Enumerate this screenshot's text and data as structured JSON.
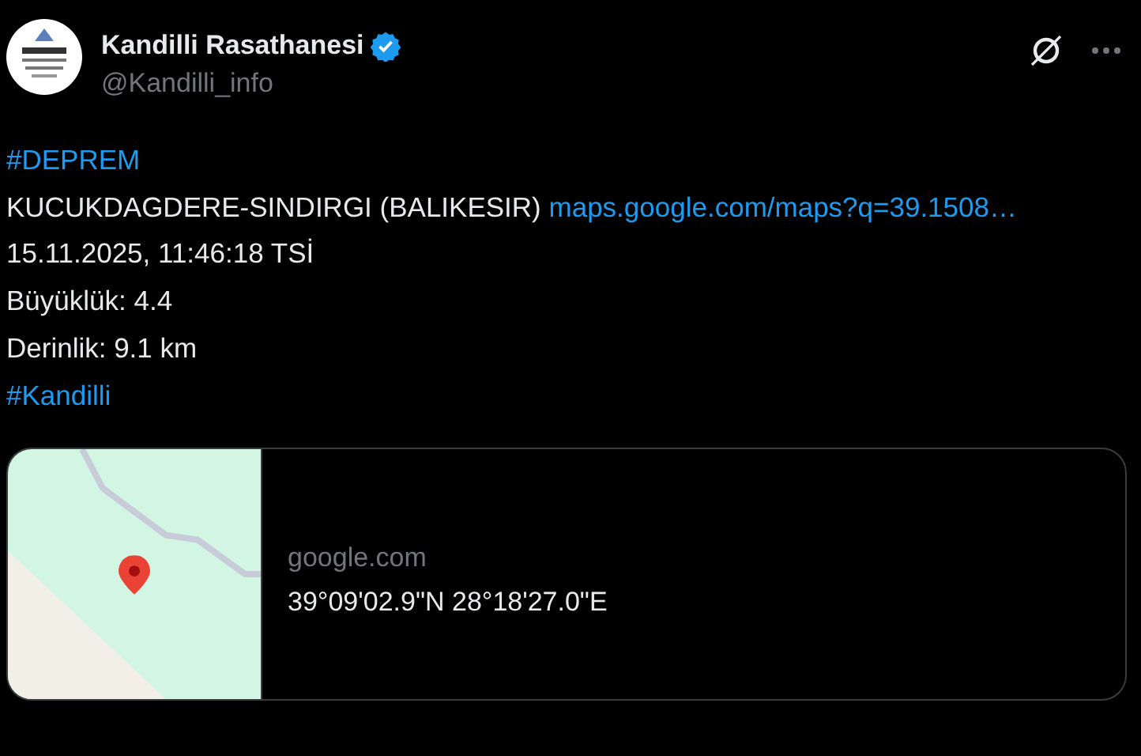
{
  "author": {
    "name": "Kandilli Rasathanesi",
    "verified": true,
    "handle": "@Kandilli_info"
  },
  "lines": [
    {
      "kind": "hashtag",
      "text": "#DEPREM"
    },
    {
      "kind": "mixed",
      "text": "KUCUKDAGDERE-SINDIRGI (BALIKESIR)",
      "link": "maps.google.com/maps?q=39.1508…"
    },
    {
      "kind": "plain",
      "text": "15.11.2025, 11:46:18 TSİ"
    },
    {
      "kind": "plain",
      "text": "Büyüklük: 4.4"
    },
    {
      "kind": "plain",
      "text": "Derinlik: 9.1 km"
    },
    {
      "kind": "hashtag",
      "text": "#Kandilli"
    }
  ],
  "card": {
    "kind": "picture",
    "domain": "google.com",
    "title": "39°09'02.9\"N 28°18'27.0\"E"
  }
}
